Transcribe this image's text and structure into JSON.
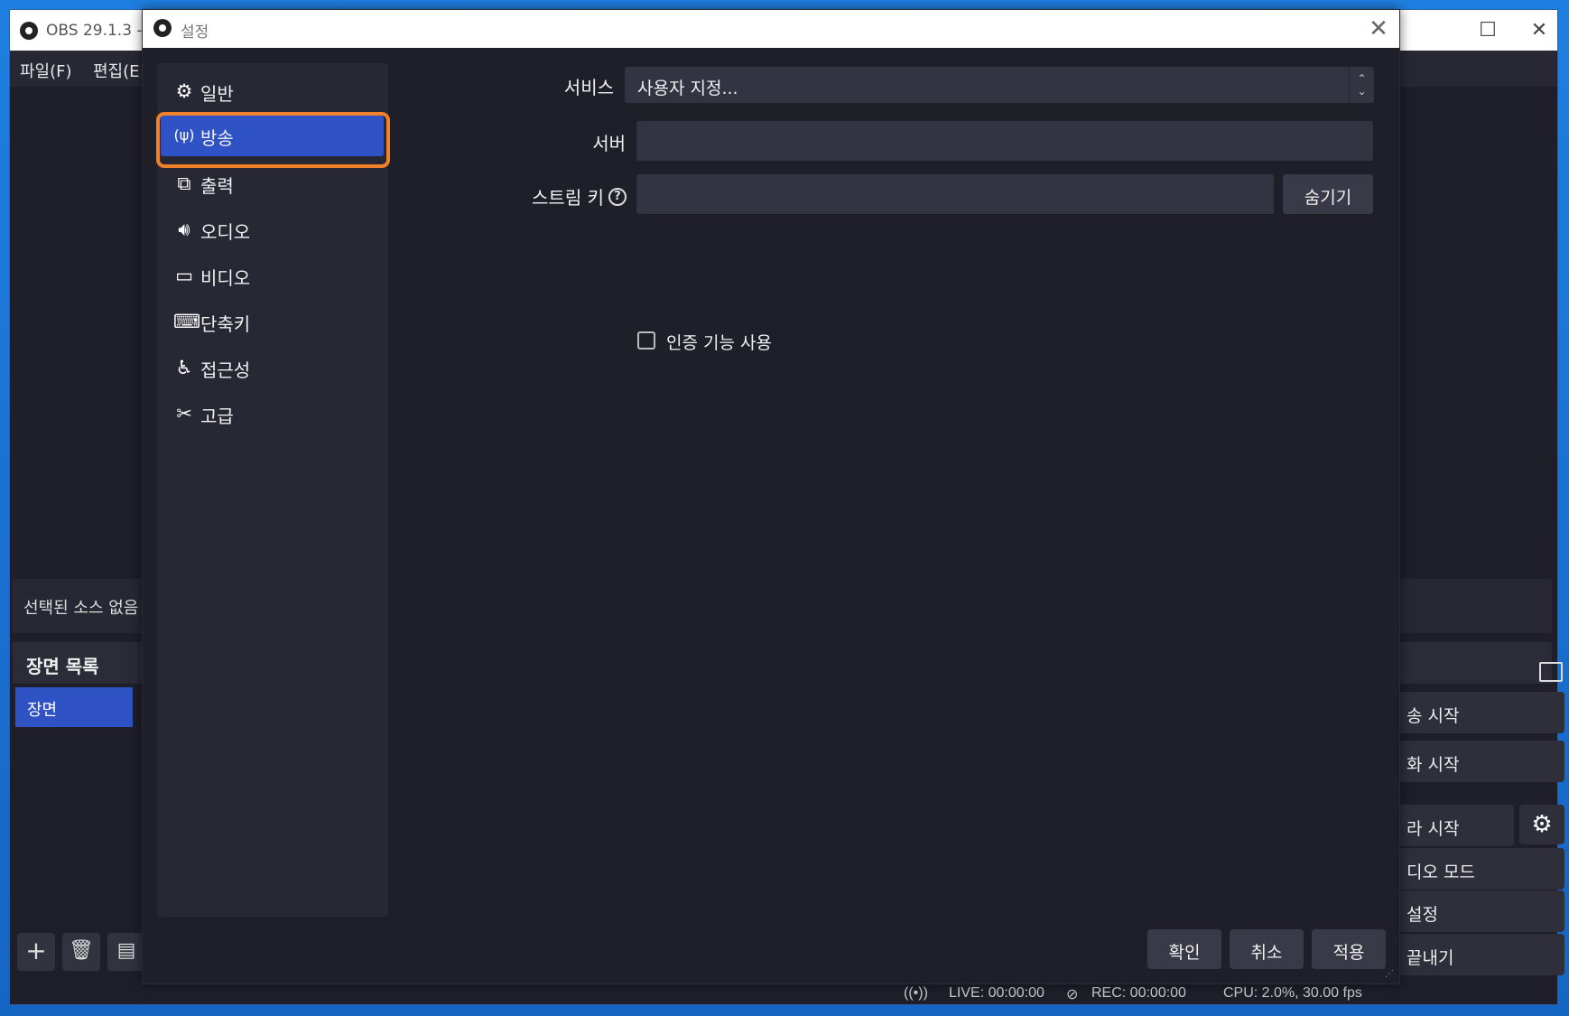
{
  "main_window": {
    "title": "OBS 29.1.3 -",
    "menu": [
      "파일(F)",
      "편집(E"
    ],
    "source_bar_text": "선택된 소스 없음",
    "scenes_header": "장면 목록",
    "scene_items": [
      "장면"
    ],
    "scene_tools": {
      "add": "+",
      "remove": "🗑",
      "filter": "▤"
    },
    "controls": [
      "송 시작",
      "화 시작",
      "라 시작",
      "디오 모드",
      "설정",
      "끝내기"
    ],
    "status": {
      "live": "LIVE: 00:00:00",
      "rec": "REC: 00:00:00",
      "cpu": "CPU: 2.0%, 30.00 fps"
    }
  },
  "dialog": {
    "title": "설정",
    "sidebar": [
      {
        "label": "일반",
        "icon": "gear-icon"
      },
      {
        "label": "방송",
        "icon": "antenna-icon",
        "active": true
      },
      {
        "label": "출력",
        "icon": "output-icon"
      },
      {
        "label": "오디오",
        "icon": "speaker-icon"
      },
      {
        "label": "비디오",
        "icon": "monitor-icon"
      },
      {
        "label": "단축키",
        "icon": "keyboard-icon"
      },
      {
        "label": "접근성",
        "icon": "accessibility-icon"
      },
      {
        "label": "고급",
        "icon": "tools-icon"
      }
    ],
    "service_label": "서비스",
    "service_value": "사용자 지정...",
    "server_label": "서버",
    "server_value": "",
    "stream_key_label": "스트림 키",
    "stream_key_value": "",
    "hide_button": "숨기기",
    "auth_label": "인증 기능 사용",
    "auth_checked": false,
    "buttons": {
      "ok": "확인",
      "cancel": "취소",
      "apply": "적용"
    }
  },
  "colors": {
    "accent": "#2f52c4",
    "highlight_outline": "#f0802a",
    "background": "#1e1f29",
    "panel": "#272834"
  }
}
